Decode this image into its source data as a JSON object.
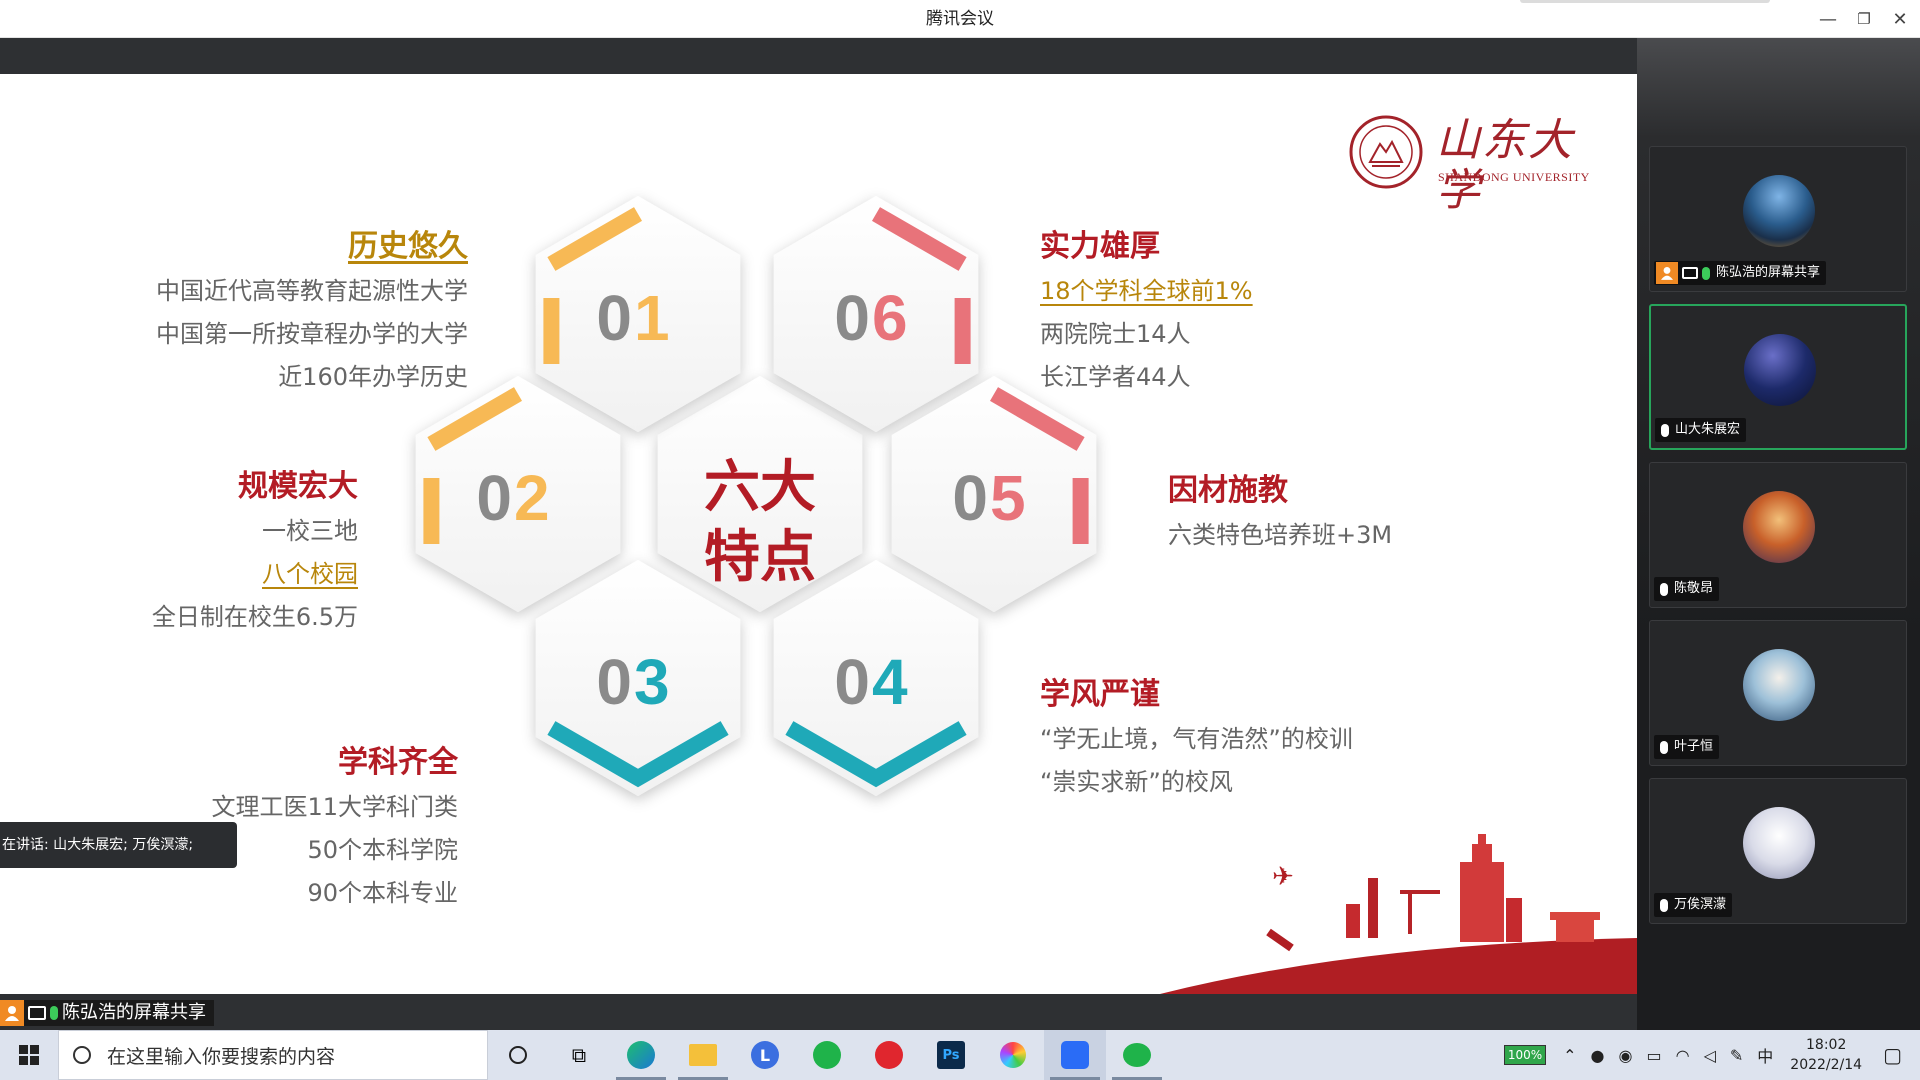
{
  "window": {
    "title": "腾讯会议"
  },
  "slide": {
    "logo": {
      "cn": "山东大学",
      "en": "SHANDONG UNIVERSITY"
    },
    "center": {
      "line1": "六大",
      "line2": "特点"
    },
    "hexes": [
      {
        "num": "01",
        "accent": "#f7b955"
      },
      {
        "num": "06",
        "accent": "#e8737a"
      },
      {
        "num": "02",
        "accent": "#f7b955"
      },
      {
        "num": "05",
        "accent": "#e8737a"
      },
      {
        "num": "03",
        "accent": "#1fa9b8"
      },
      {
        "num": "04",
        "accent": "#1fa9b8"
      }
    ],
    "blocks": {
      "history": {
        "title": "历史悠久",
        "lines": [
          "中国近代高等教育起源性大学",
          "中国第一所按章程办学的大学",
          "近160年办学历史"
        ]
      },
      "scale": {
        "title": "规模宏大",
        "lines": [
          "一校三地",
          "八个校园",
          "全日制在校生6.5万"
        ]
      },
      "subjects": {
        "title": "学科齐全",
        "lines": [
          "文理工医11大学科门类",
          "50个本科学院",
          "90个本科专业"
        ]
      },
      "strength": {
        "title": "实力雄厚",
        "lines": [
          "18个学科全球前1%",
          "两院院士14人",
          "长江学者44人"
        ]
      },
      "teaching": {
        "title": "因材施教",
        "lines": [
          "六类特色培养班+3M"
        ]
      },
      "style": {
        "title": "学风严谨",
        "lines": [
          "“学无止境，气有浩然”的校训",
          "“崇实求新”的校风"
        ]
      }
    }
  },
  "speaking": "在讲话: 山大朱展宏; 万俟溟濛;",
  "share_label": "陈弘浩的屏幕共享",
  "participants": [
    {
      "name": "陈弘浩的屏幕共享"
    },
    {
      "name": "山大朱展宏"
    },
    {
      "name": "陈敬昂"
    },
    {
      "name": "叶子恒"
    },
    {
      "name": "万俟溟濛"
    }
  ],
  "taskbar": {
    "search_placeholder": "在这里输入你要搜索的内容",
    "battery": "100%",
    "ime": "中",
    "time": "18:02",
    "date": "2022/2/14",
    "apps": [
      "task-view",
      "edge",
      "file-explorer",
      "app-l",
      "app-green",
      "netease-music",
      "photoshop",
      "color-wheel",
      "tencent-meeting",
      "wechat"
    ]
  }
}
